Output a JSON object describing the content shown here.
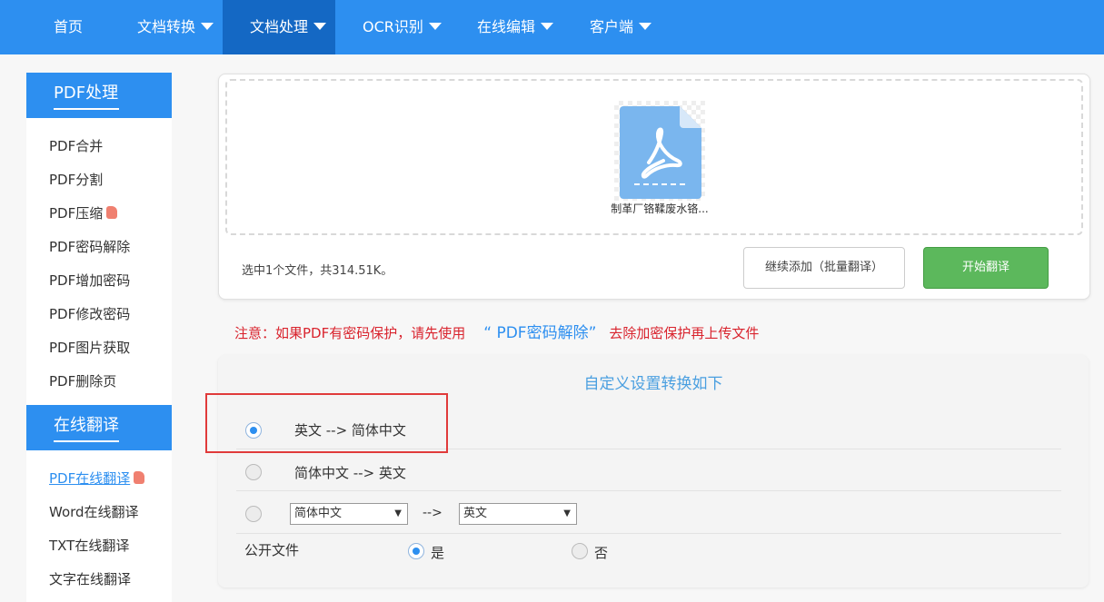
{
  "nav": {
    "items": [
      {
        "label": "首页",
        "dropdown": false
      },
      {
        "label": "文档转换",
        "dropdown": true
      },
      {
        "label": "文档处理",
        "dropdown": true,
        "active": true
      },
      {
        "label": "OCR识别",
        "dropdown": true
      },
      {
        "label": "在线编辑",
        "dropdown": true
      },
      {
        "label": "客户端",
        "dropdown": true
      }
    ]
  },
  "sidebar": {
    "pdf_section": {
      "title": "PDF处理",
      "items": [
        "PDF合并",
        "PDF分割",
        "PDF压缩",
        "PDF密码解除",
        "PDF增加密码",
        "PDF修改密码",
        "PDF图片获取",
        "PDF删除页"
      ]
    },
    "translate_section": {
      "title": "在线翻译",
      "items": [
        "PDF在线翻译",
        "Word在线翻译",
        "TXT在线翻译",
        "文字在线翻译"
      ],
      "active_item": "PDF在线翻译"
    }
  },
  "upload": {
    "file_name": "制革厂铬鞣废水铬...",
    "file_type_icon": "pdf-file-icon",
    "selection_info": "选中1个文件，共314.51K。",
    "add_button": "继续添加（批量翻译）",
    "start_button": "开始翻译"
  },
  "notice": {
    "prefix": "注意：如果PDF有密码保护，请先使用",
    "link": "“ PDF密码解除”",
    "suffix": "去除加密保护再上传文件"
  },
  "settings": {
    "title": "自定义设置转换如下",
    "option1": "英文 --> 简体中文",
    "option2": "简体中文 --> 英文",
    "custom": {
      "from": "简体中文",
      "arrow": "-->",
      "to": "英文"
    },
    "public_label": "公开文件",
    "public_yes": "是",
    "public_no": "否",
    "selected_option": 1,
    "public_selected": "是"
  },
  "colors": {
    "nav_bg": "#2d8ff0",
    "nav_active": "#1468c4",
    "start_button": "#5cb85c",
    "notice_red": "#d9232d",
    "highlight_box": "#e03a3a"
  }
}
